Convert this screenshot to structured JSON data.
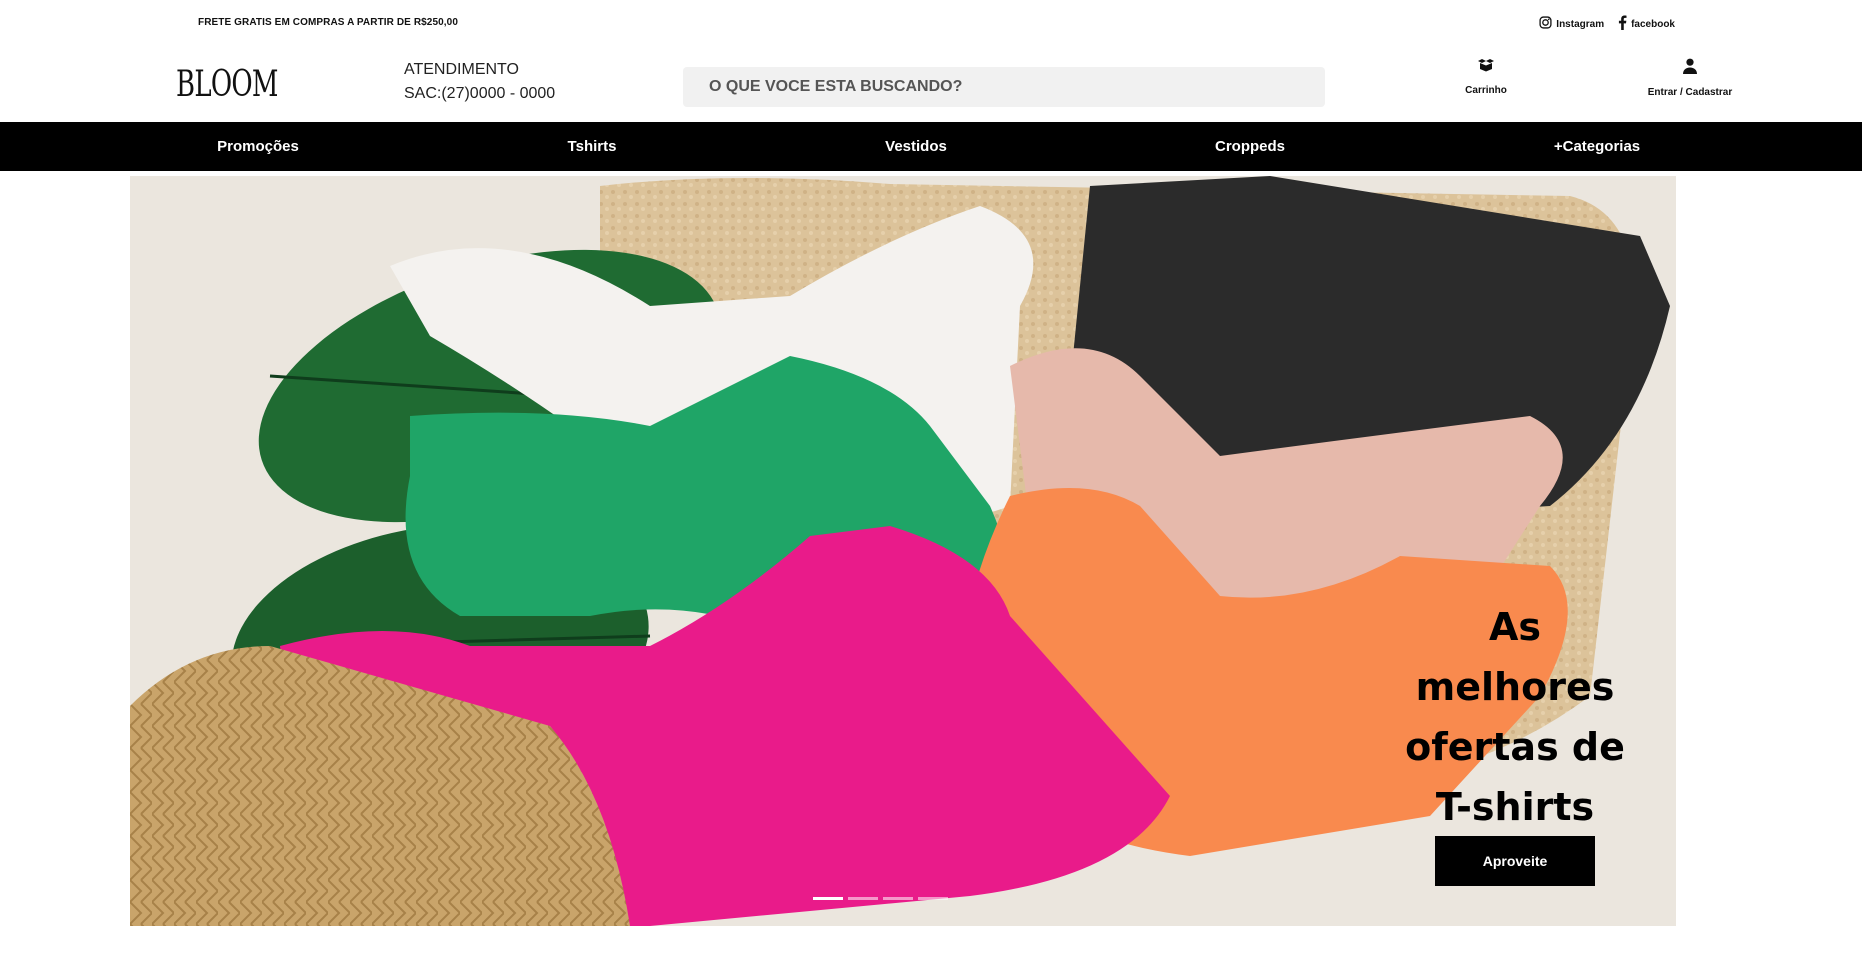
{
  "topbar": {
    "promo": "FRETE GRATIS EM COMPRAS A PARTIR DE R$250,00",
    "instagram_label": "Instagram",
    "facebook_label": "facebook"
  },
  "header": {
    "logo": "BLOOM",
    "atendimento_title": "ATENDIMENTO",
    "atendimento_phone": "SAC:(27)0000 - 0000",
    "search_placeholder": "O QUE VOCE ESTA BUSCANDO?",
    "cart_label": "Carrinho",
    "account_label": "Entrar / Cadastrar"
  },
  "nav": {
    "items": [
      {
        "label": "Promoções"
      },
      {
        "label": "Tshirts"
      },
      {
        "label": "Vestidos"
      },
      {
        "label": "Croppeds"
      },
      {
        "label": "+Categorias"
      }
    ]
  },
  "hero": {
    "headline": "As melhores ofertas de T-shirts",
    "cta_label": "Aproveite",
    "slides_count": 4,
    "active_slide": 1
  },
  "icons": {
    "instagram": "instagram-icon",
    "facebook": "facebook-icon",
    "cart": "cart-icon",
    "user": "user-icon"
  },
  "colors": {
    "nav_bg": "#000000",
    "search_bg": "#f1f1f1",
    "cta_bg": "#000000"
  }
}
